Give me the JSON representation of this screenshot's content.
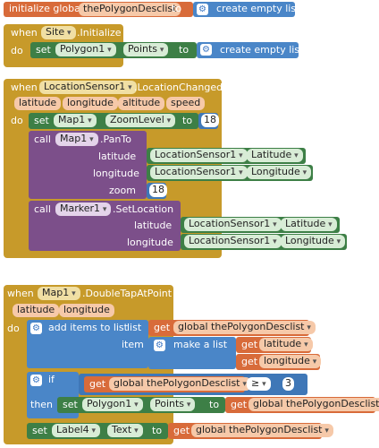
{
  "colors": {
    "variables": "#d86b3a",
    "events": "#c79a2a",
    "components": "#3d7f46",
    "calls": "#7c4f8a",
    "lists": "#4a86c8"
  },
  "block1": {
    "initialize_global": "initialize global",
    "var_name": "thePolygonDesclist",
    "to": "to",
    "gear_icon": "gear-icon",
    "create_empty_list": "create empty list"
  },
  "block2": {
    "when": "when",
    "component": "Site",
    "event": ".Initialize",
    "do": "do",
    "set": "set",
    "set_component": "Polygon1",
    "set_property": "Points",
    "to": "to",
    "create_empty_list": "create empty list"
  },
  "block3": {
    "when": "when",
    "component": "LocationSensor1",
    "event": ".LocationChanged",
    "params": [
      "latitude",
      "longitude",
      "altitude",
      "speed"
    ],
    "do": "do",
    "set": "set",
    "set_component": "Map1",
    "set_property": "ZoomLevel",
    "to": "to",
    "zoom_value": "18",
    "call1": "call",
    "call1_component": "Map1",
    "call1_method": ".PanTo",
    "latitude_label": "latitude",
    "longitude_label": "longitude",
    "zoom_label": "zoom",
    "pan_lat_component": "LocationSensor1",
    "pan_lat_property": "Latitude",
    "pan_lon_component": "LocationSensor1",
    "pan_lon_property": "Longitude",
    "pan_zoom_value": "18",
    "call2": "call",
    "call2_component": "Marker1",
    "call2_method": ".SetLocation",
    "marker_lat_component": "LocationSensor1",
    "marker_lat_property": "Latitude",
    "marker_lon_component": "LocationSensor1",
    "marker_lon_property": "Longitude"
  },
  "block4": {
    "when": "when",
    "component": "Map1",
    "event": ".DoubleTapAtPoint",
    "params": [
      "latitude",
      "longitude"
    ],
    "do": "do",
    "add_items": "add items to list",
    "list_label": "list",
    "get": "get",
    "global_var": "global thePolygonDesclist",
    "item_label": "item",
    "make_a_list": "make a list",
    "get_lat": "latitude",
    "get_lon": "longitude",
    "if": "if",
    "compare_op": "≥",
    "compare_value": "3",
    "then": "then",
    "set": "set",
    "set_component": "Polygon1",
    "set_property": "Points",
    "to": "to",
    "set2_component": "Label4",
    "set2_property": "Text"
  }
}
